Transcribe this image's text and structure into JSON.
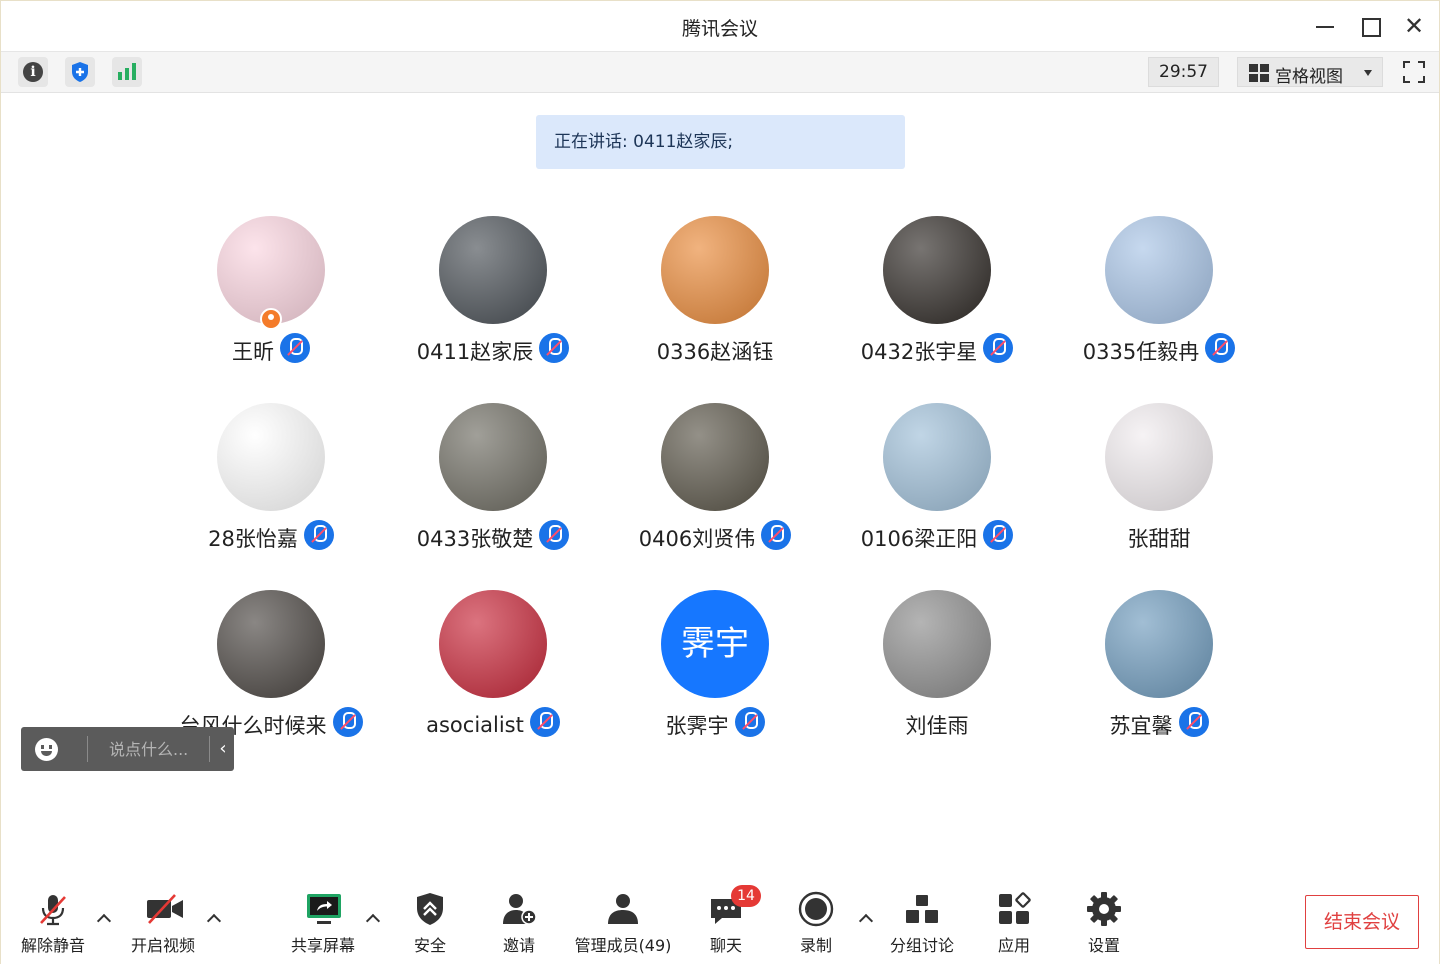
{
  "window": {
    "title": "腾讯会议"
  },
  "infobar": {
    "timer": "29:57",
    "view_mode": "宫格视图"
  },
  "speaking": {
    "text": "正在讲话: 0411赵家辰;"
  },
  "participants": [
    {
      "name": "王昕",
      "mic_muted": true,
      "avatar_color": "#fbd5e0",
      "host": true
    },
    {
      "name": "0411赵家辰",
      "mic_muted": true,
      "avatar_color": "#4a5056"
    },
    {
      "name": "0336赵涵钰",
      "mic_muted": false,
      "avatar_color": "#e98a3a"
    },
    {
      "name": "0432张宇星",
      "mic_muted": true,
      "avatar_color": "#2f2a26"
    },
    {
      "name": "0335任毅冉",
      "mic_muted": true,
      "avatar_color": "#a8c4e6"
    },
    {
      "name": "28张怡嘉",
      "mic_muted": true,
      "avatar_color": "#ffffff"
    },
    {
      "name": "0433张敬楚",
      "mic_muted": true,
      "avatar_color": "#6e6c62"
    },
    {
      "name": "0406刘贤伟",
      "mic_muted": true,
      "avatar_color": "#5a5548"
    },
    {
      "name": "0106梁正阳",
      "mic_muted": true,
      "avatar_color": "#9fbfd8"
    },
    {
      "name": "张甜甜",
      "mic_muted": false,
      "avatar_color": "#f1ecef"
    },
    {
      "name": "台风什么时候来",
      "mic_muted": true,
      "avatar_color": "#4b4642"
    },
    {
      "name": "asocialist",
      "mic_muted": true,
      "avatar_color": "#c8283a"
    },
    {
      "name": "张霁宇",
      "mic_muted": true,
      "avatar_color": "#1677ff",
      "avatar_text": "霁宇"
    },
    {
      "name": "刘佳雨",
      "mic_muted": false,
      "avatar_color": "#8c8c8c"
    },
    {
      "name": "苏宜馨",
      "mic_muted": true,
      "avatar_color": "#6f9bbd"
    }
  ],
  "chat": {
    "placeholder": "说点什么..."
  },
  "toolbar": {
    "unmute": "解除静音",
    "video": "开启视频",
    "share": "共享屏幕",
    "security": "安全",
    "invite": "邀请",
    "members": "管理成员(49)",
    "chat": "聊天",
    "chat_badge": "14",
    "record": "录制",
    "breakout": "分组讨论",
    "apps": "应用",
    "settings": "设置",
    "end": "结束会议"
  },
  "colors": {
    "accent": "#1a73e8",
    "danger": "#e04040",
    "banner": "#dbe8fb",
    "signal": "#27ae60"
  }
}
